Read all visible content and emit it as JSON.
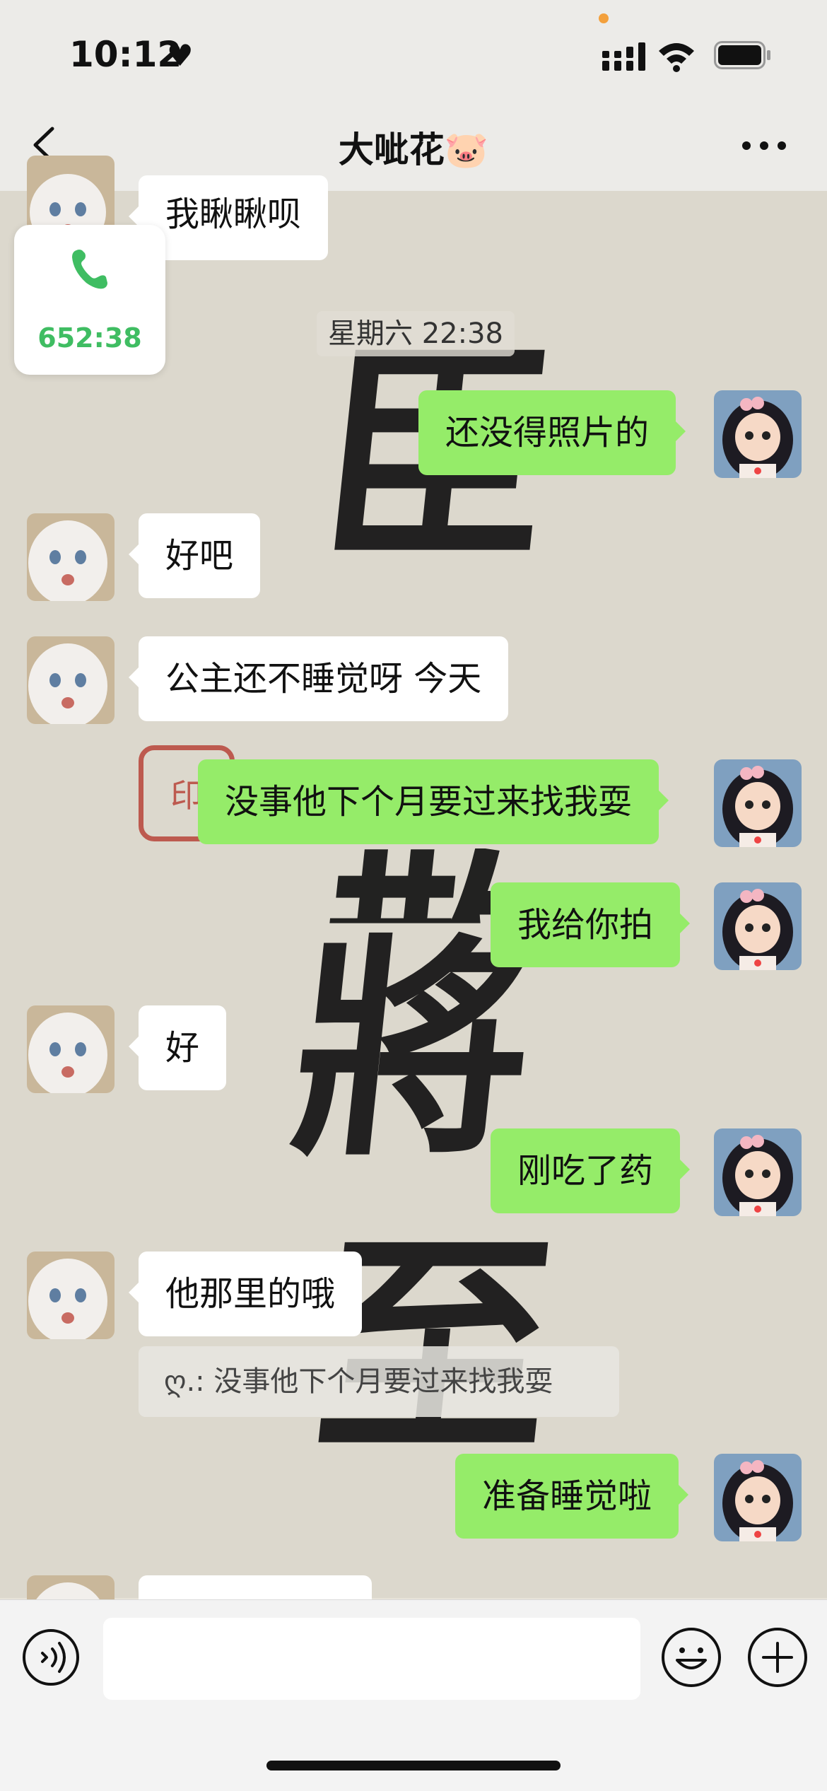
{
  "status_bar": {
    "time": "10:12",
    "heart": "♥"
  },
  "nav": {
    "title": "大呲花🐷"
  },
  "background": {
    "chars": [
      "臣",
      "散",
      "將",
      "至"
    ],
    "seal": "印"
  },
  "call_card": {
    "duration": "652:38"
  },
  "timestamp": "星期六 22:38",
  "messages": [
    {
      "side": "in",
      "text": "我瞅瞅呗"
    },
    {
      "side": "out",
      "text": "还没得照片的"
    },
    {
      "side": "in",
      "text": "好吧"
    },
    {
      "side": "in",
      "text": "公主还不睡觉呀 今天"
    },
    {
      "side": "out",
      "text": "没事他下个月要过来找我耍"
    },
    {
      "side": "out",
      "text": "我给你拍"
    },
    {
      "side": "in",
      "text": "好"
    },
    {
      "side": "out",
      "text": "刚吃了药"
    },
    {
      "side": "in",
      "text": "他那里的哦",
      "quote": "ღ.: 没事他下个月要过来找我耍"
    },
    {
      "side": "out",
      "text": "准备睡觉啦"
    },
    {
      "side": "in",
      "text": ""
    }
  ],
  "input": {
    "placeholder": ""
  },
  "colors": {
    "accent_green": "#95ec69",
    "call_green": "#3fbd62",
    "seal_red": "#b8453a"
  },
  "icons": [
    "back-icon",
    "more-icon",
    "signal-icon",
    "wifi-icon",
    "battery-icon",
    "phone-icon",
    "voice-icon",
    "emoji-icon",
    "plus-icon"
  ]
}
